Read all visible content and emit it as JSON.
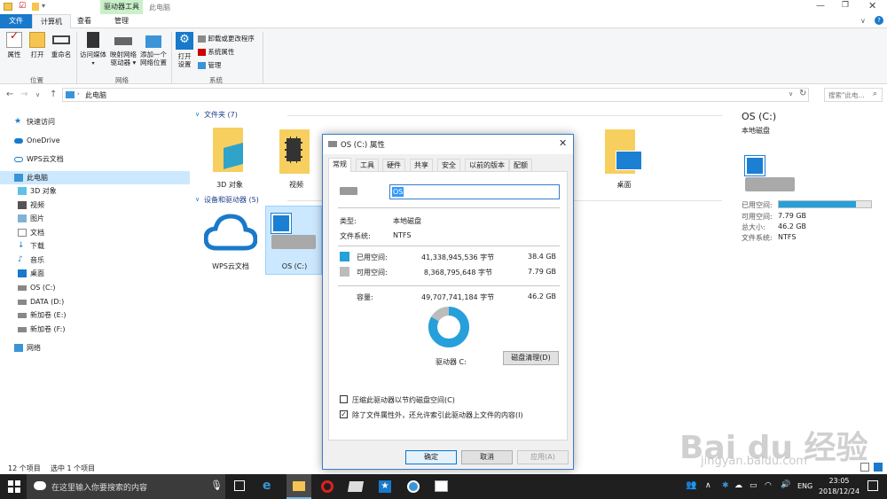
{
  "titlebar": {
    "window_title": "此电脑",
    "context_tab": "驱动器工具"
  },
  "ribbon_tabs": {
    "file": "文件",
    "computer": "计算机",
    "view": "查看",
    "manage": "管理"
  },
  "ribbon": {
    "location": {
      "group": "位置",
      "properties": "属性",
      "open": "打开",
      "rename": "重命名"
    },
    "network": {
      "group": "网络",
      "access_media": "访问媒体",
      "map_drive_1": "映射网络",
      "map_drive_2": "驱动器",
      "add_location_1": "添加一个",
      "add_location_2": "网络位置"
    },
    "system": {
      "group": "系统",
      "open_settings_1": "打开",
      "open_settings_2": "设置",
      "uninstall": "卸载或更改程序",
      "system_props": "系统属性",
      "manage": "管理"
    }
  },
  "address": {
    "path": "此电脑",
    "search_placeholder": "搜索\"此电..."
  },
  "sidebar": {
    "items": [
      {
        "label": "快速访问"
      },
      {
        "label": "OneDrive"
      },
      {
        "label": "WPS云文档"
      },
      {
        "label": "此电脑"
      },
      {
        "label": "3D 对象"
      },
      {
        "label": "视频"
      },
      {
        "label": "图片"
      },
      {
        "label": "文档"
      },
      {
        "label": "下载"
      },
      {
        "label": "音乐"
      },
      {
        "label": "桌面"
      },
      {
        "label": "OS (C:)"
      },
      {
        "label": "DATA (D:)"
      },
      {
        "label": "新加卷 (E:)"
      },
      {
        "label": "新加卷 (F:)"
      },
      {
        "label": "网络"
      }
    ]
  },
  "main": {
    "folders_header": "文件夹 (7)",
    "folders": [
      "3D 对象",
      "视频",
      "桌面"
    ],
    "drives_header": "设备和驱动器 (5)",
    "drives": [
      "WPS云文档",
      "OS (C:)"
    ]
  },
  "details": {
    "title": "OS (C:)",
    "subtitle": "本地磁盘",
    "used_label": "已用空间:",
    "free_label": "可用空间:",
    "free_value": "7.79 GB",
    "total_label": "总大小:",
    "total_value": "46.2 GB",
    "fs_label": "文件系统:",
    "fs_value": "NTFS",
    "used_fraction": 0.84
  },
  "status": {
    "count": "12 个项目",
    "selected": "选中 1 个项目"
  },
  "dialog": {
    "title": "OS (C:) 属性",
    "tabs": [
      "常规",
      "工具",
      "硬件",
      "共享",
      "安全",
      "以前的版本",
      "配额"
    ],
    "name_value": "OS",
    "type_label": "类型:",
    "type_value": "本地磁盘",
    "fs_label": "文件系统:",
    "fs_value": "NTFS",
    "used_label": "已用空间:",
    "used_bytes": "41,338,945,536 字节",
    "used_gb": "38.4 GB",
    "free_label": "可用空间:",
    "free_bytes": "8,368,795,648 字节",
    "free_gb": "7.79 GB",
    "capacity_label": "容量:",
    "capacity_bytes": "49,707,741,184 字节",
    "capacity_gb": "46.2 GB",
    "drive_label": "驱动器 C:",
    "cleanup_button": "磁盘清理(D)",
    "compress_label": "压缩此驱动器以节约磁盘空间(C)",
    "index_label": "除了文件属性外，还允许索引此驱动器上文件的内容(I)",
    "ok": "确定",
    "cancel": "取消",
    "apply": "应用(A)",
    "used_fraction": 0.832
  },
  "taskbar": {
    "search_placeholder": "在这里输入你要搜索的内容",
    "lang": "ENG",
    "time": "23:05",
    "date": "2018/12/24"
  },
  "watermark": {
    "brand": "Bai du 经验",
    "url": "jingyan.baidu.com"
  },
  "colors": {
    "used": "#26a0da",
    "free": "#bcbcbc",
    "accent": "#1979ca",
    "context_tab": "#c9f0c9",
    "selection": "#cce8ff"
  }
}
